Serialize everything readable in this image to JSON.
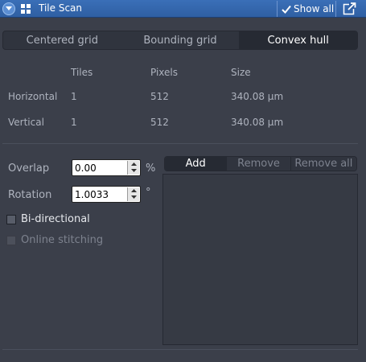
{
  "header": {
    "title": "Tile Scan",
    "show_all_label": "Show all",
    "colors": {
      "bar": "#3366aa",
      "text": "#ffffff"
    }
  },
  "tabs": [
    {
      "label": "Centered grid",
      "active": false
    },
    {
      "label": "Bounding grid",
      "active": false
    },
    {
      "label": "Convex hull",
      "active": true
    }
  ],
  "info": {
    "columns": [
      "Tiles",
      "Pixels",
      "Size"
    ],
    "rows": [
      {
        "label": "Horizontal",
        "tiles": "1",
        "pixels": "512",
        "size": "340.08 µm"
      },
      {
        "label": "Vertical",
        "tiles": "1",
        "pixels": "512",
        "size": "340.08 µm"
      }
    ]
  },
  "overlap": {
    "label": "Overlap",
    "value": "0.00",
    "unit": "%"
  },
  "rotation": {
    "label": "Rotation",
    "value": "1.0033",
    "unit": "°"
  },
  "options": {
    "bidirectional": {
      "label": "Bi-directional",
      "checked": false
    },
    "online_stitching": {
      "label": "Online stitching",
      "checked": false,
      "enabled": false
    }
  },
  "positions": {
    "add_label": "Add",
    "remove_label": "Remove",
    "remove_all_label": "Remove all"
  }
}
